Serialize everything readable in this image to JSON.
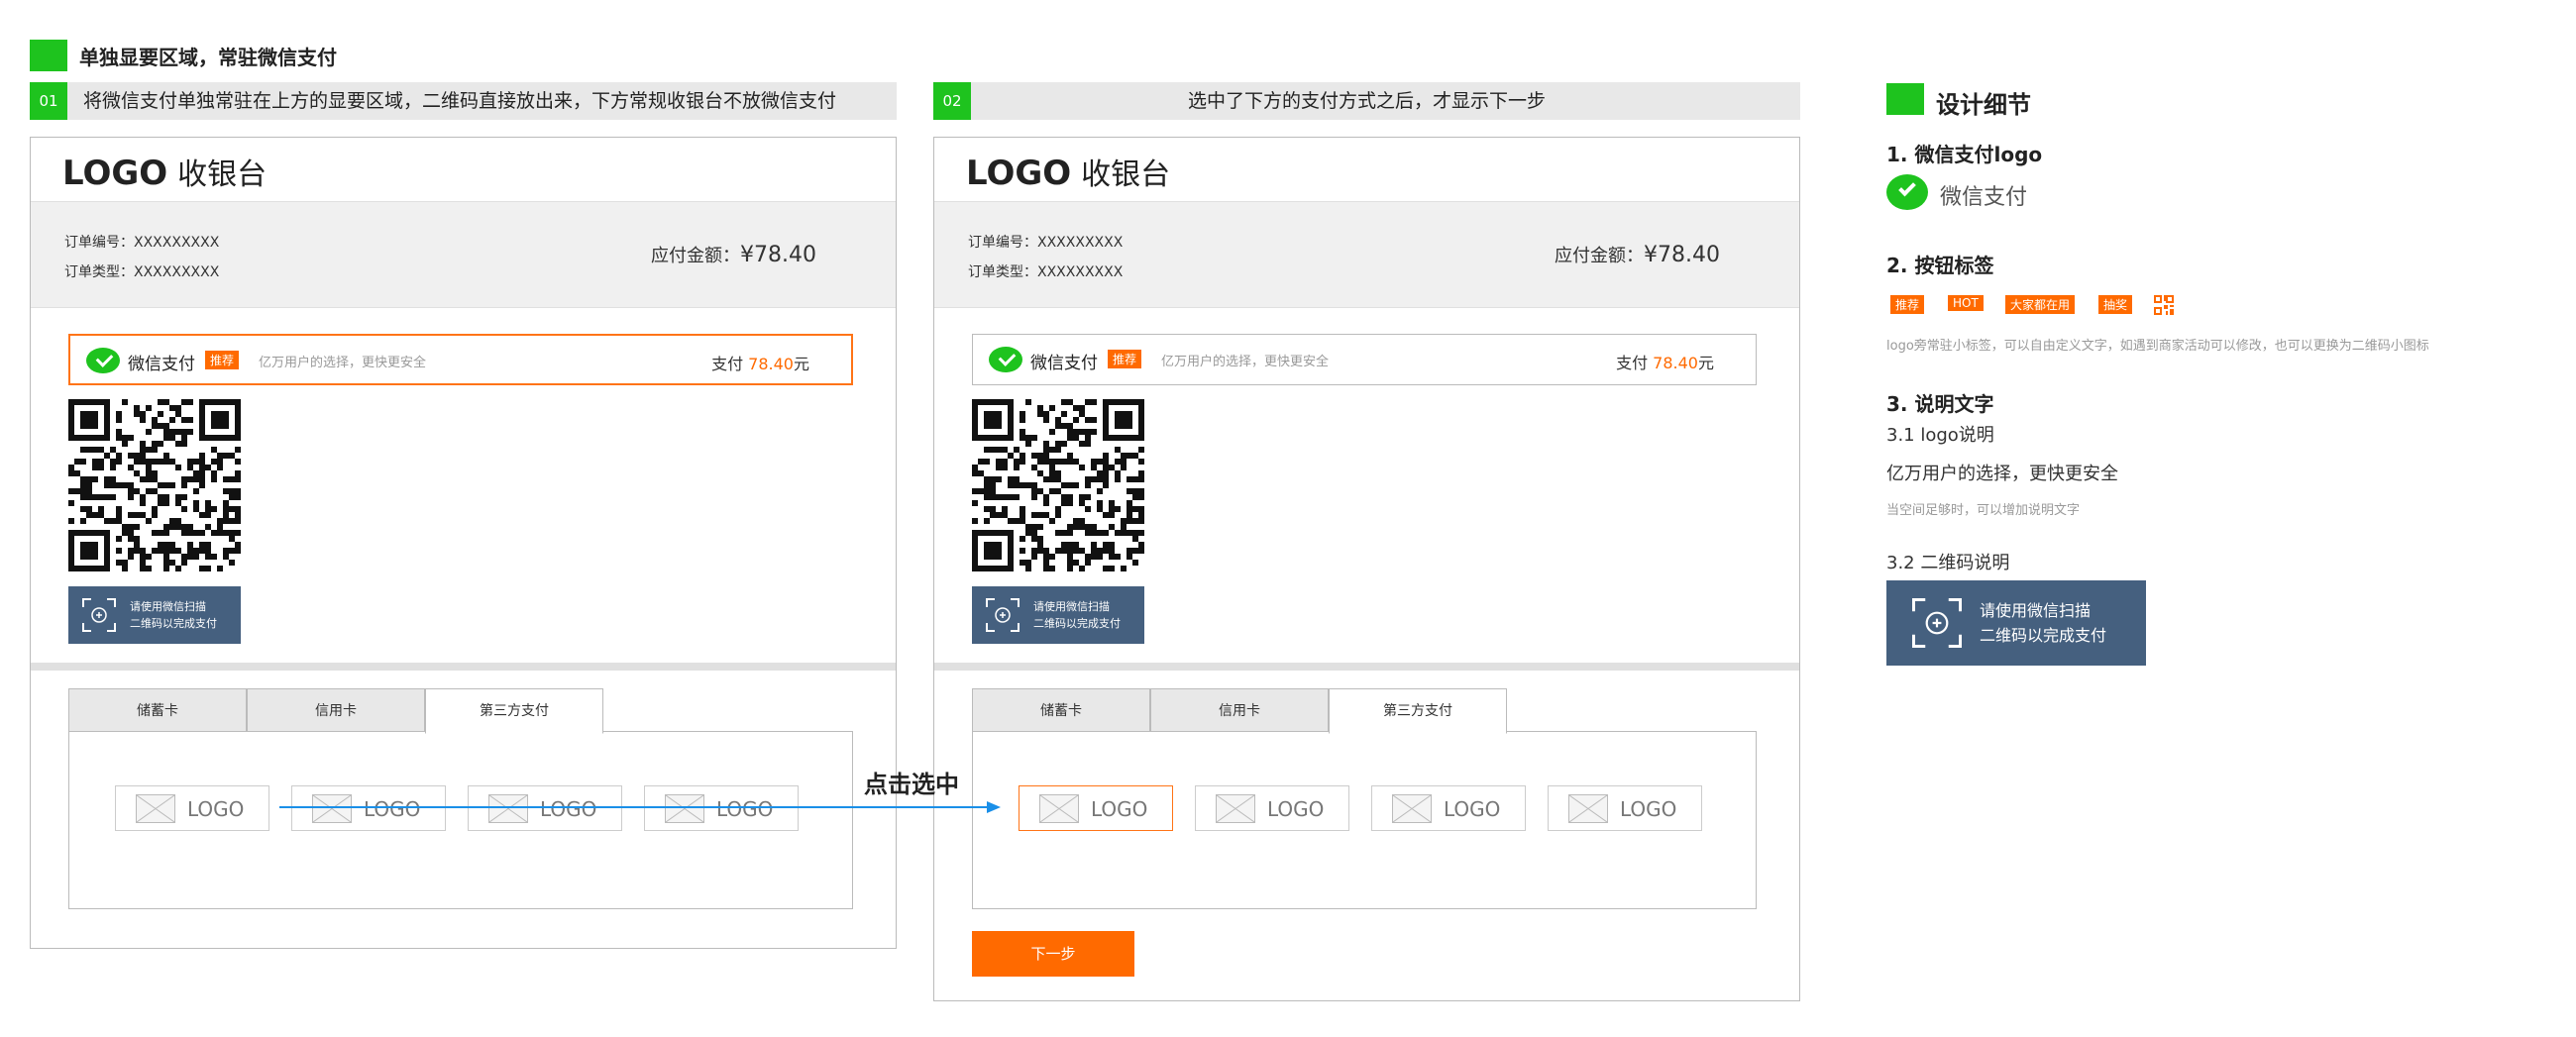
{
  "header": {
    "title": "单独显要区域，常驻微信支付"
  },
  "strips": [
    {
      "num": "01",
      "text": "将微信支付单独常驻在上方的显要区域，二维码直接放出来，下方常规收银台不放微信支付"
    },
    {
      "num": "02",
      "text": "选中了下方的支付方式之后，才显示下一步"
    }
  ],
  "cashier": {
    "logo": "LOGO",
    "title": "收银台",
    "order_no": "订单编号：XXXXXXXXX",
    "order_type": "订单类型：XXXXXXXXX",
    "amount_label": "应付金额：",
    "amount_value": "¥78.40",
    "wechat_name": "微信支付",
    "wechat_tag": "推荐",
    "wechat_desc": "亿万用户的选择，更快更安全",
    "pay_prefix": "支付 ",
    "pay_amount": "78.40",
    "pay_suffix": "元",
    "scan_line1": "请使用微信扫描",
    "scan_line2": "二维码以完成支付",
    "tabs": [
      "储蓄卡",
      "信用卡",
      "第三方支付"
    ],
    "active_tab": "第三方支付",
    "bank_logo": "LOGO",
    "next_button": "下一步"
  },
  "arrow_label": "点击选中",
  "details": {
    "title": "设计细节",
    "s1_title": "1. 微信支付logo",
    "s1_name": "微信支付",
    "s2_title": "2. 按钮标签",
    "s2_tags": [
      "推荐",
      "HOT",
      "大家都在用",
      "抽奖"
    ],
    "s2_note": "logo旁常驻小标签，可以自由定义文字，如遇到商家活动可以修改，也可以更换为二维码小图标",
    "s3_title": "3. 说明文字",
    "s31_title": "3.1 logo说明",
    "s31_text": "亿万用户的选择，更快更安全",
    "s31_note": "当空间足够时，可以增加说明文字",
    "s32_title": "3.2 二维码说明",
    "s32_line1": "请使用微信扫描",
    "s32_line2": "二维码以完成支付"
  },
  "colors": {
    "wechat_green": "#1ec31e",
    "accent_orange": "#ff6a00",
    "scan_button": "#45607f",
    "arrow_blue": "#1a8fe8"
  }
}
